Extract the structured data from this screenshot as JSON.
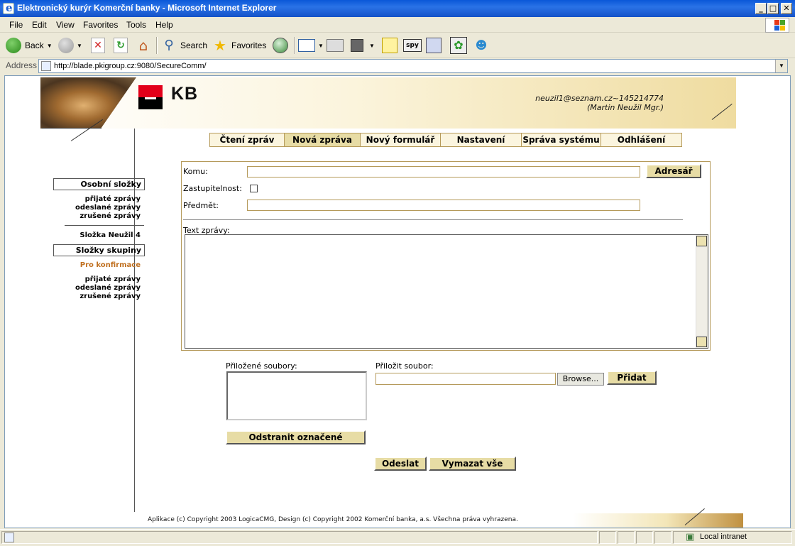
{
  "window": {
    "title": "Elektronický kurýr Komerční banky - Microsoft Internet Explorer"
  },
  "menu": [
    "File",
    "Edit",
    "View",
    "Favorites",
    "Tools",
    "Help"
  ],
  "toolbar": {
    "back": "Back",
    "search": "Search",
    "favorites": "Favorites"
  },
  "address": {
    "label": "Address",
    "url": "http://blade.pkigroup.cz:9080/SecureComm/"
  },
  "banner": {
    "logo_text": "KB",
    "user_email": "neuzil1@seznam.cz~145214774",
    "user_name": "(Martin Neužil Mgr.)"
  },
  "tabs": [
    {
      "label": "Čtení zpráv"
    },
    {
      "label": "Nová zpráva"
    },
    {
      "label": "Nový formulář"
    },
    {
      "label": "Nastavení"
    },
    {
      "label": "Správa systému"
    },
    {
      "label": "Odhlášení"
    }
  ],
  "sidebar": {
    "personal_heading": "Osobní složky",
    "personal_items": [
      "přijaté zprávy",
      "odeslané zprávy",
      "zrušené zprávy"
    ],
    "custom_folder": "Složka Neužil 4",
    "group_heading": "Složky skupiny",
    "group_sub": "Pro konfirmace",
    "group_items": [
      "přijaté zprávy",
      "odeslané zprávy",
      "zrušené zprávy"
    ]
  },
  "form": {
    "to_label": "Komu:",
    "address_book_button": "Adresář",
    "substitute_label": "Zastupitelnost:",
    "subject_label": "Předmět:",
    "body_label": "Text zprávy:",
    "attached_label": "Přiložené soubory:",
    "attach_label": "Přiložit soubor:",
    "browse_button": "Browse...",
    "add_button": "Přidat",
    "remove_button": "Odstranit označené",
    "send_button": "Odeslat",
    "clear_button": "Vymazat vše"
  },
  "footer": {
    "text": "Aplikace (c) Copyright 2003 LogicaCMG, Design (c) Copyright 2002 Komerční banka, a.s. Všechna práva vyhrazena."
  },
  "status": {
    "zone": "Local intranet"
  }
}
